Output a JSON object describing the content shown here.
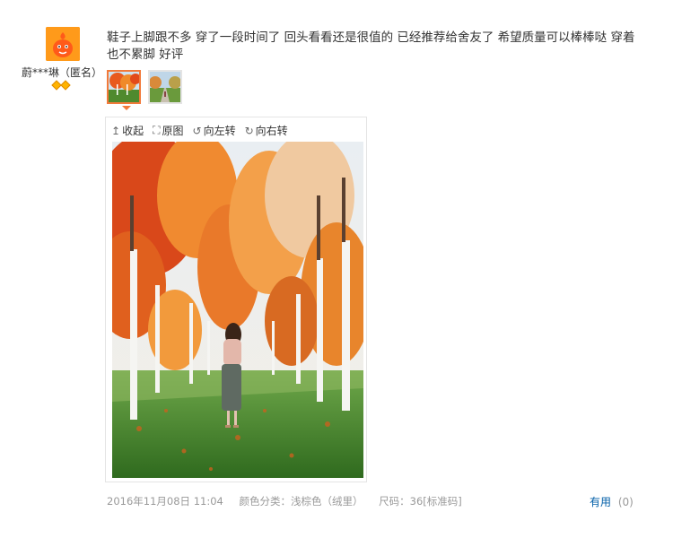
{
  "user": {
    "name": "蔚***琳（匿名）",
    "avatar_icon": "jd-mascot-avatar-icon",
    "rank_icon": "diamond-rank-icon"
  },
  "review": {
    "text": "鞋子上脚跟不多 穿了一段时间了 回头看看还是很值的 已经推荐给舍友了 希望质量可以棒棒哒 穿着也不累脚 好评"
  },
  "viewer": {
    "collapse_label": "收起",
    "original_label": "原图",
    "rotate_left_label": "向左转",
    "rotate_right_label": "向右转"
  },
  "meta": {
    "date": "2016年11月08日 11:04",
    "color": "颜色分类：浅棕色（绒里）",
    "size": "尺码：36[标准码]"
  },
  "helpful": {
    "label": "有用",
    "count": "(0)"
  },
  "colors": {
    "accent_orange": "#f27a3a",
    "link_blue": "#005ea7",
    "meta_gray": "#999999"
  }
}
